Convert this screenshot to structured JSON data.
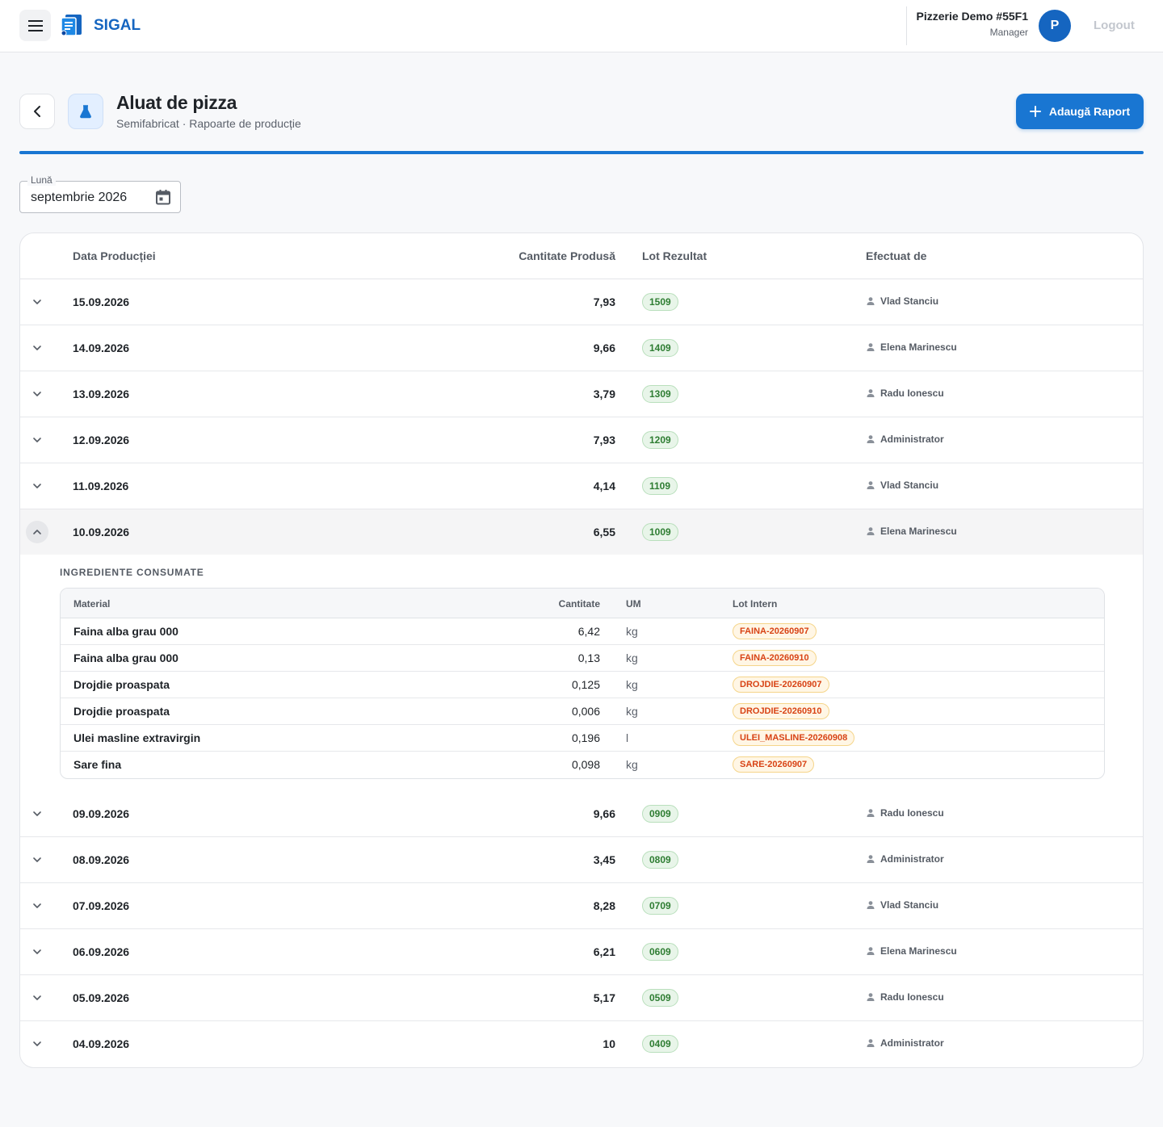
{
  "app": {
    "brand": "SIGAL",
    "org_name": "Pizzerie Demo #55F1",
    "org_role": "Manager",
    "avatar_letter": "P",
    "logout_label": "Logout"
  },
  "page": {
    "title": "Aluat de pizza",
    "subtitle": "Semifabricat · Rapoarte de producție",
    "add_button_label": "Adaugă Raport"
  },
  "filter": {
    "month_label": "Lună",
    "month_value": "septembrie 2026"
  },
  "table": {
    "headers": {
      "date": "Data Producției",
      "qty": "Cantitate Produsă",
      "lot": "Lot Rezultat",
      "user": "Efectuat de"
    },
    "rows": [
      {
        "date": "15.09.2026",
        "qty": "7,93",
        "lot": "1509",
        "user": "Vlad Stanciu"
      },
      {
        "date": "14.09.2026",
        "qty": "9,66",
        "lot": "1409",
        "user": "Elena Marinescu"
      },
      {
        "date": "13.09.2026",
        "qty": "3,79",
        "lot": "1309",
        "user": "Radu Ionescu"
      },
      {
        "date": "12.09.2026",
        "qty": "7,93",
        "lot": "1209",
        "user": "Administrator"
      },
      {
        "date": "11.09.2026",
        "qty": "4,14",
        "lot": "1109",
        "user": "Vlad Stanciu"
      },
      {
        "date": "10.09.2026",
        "qty": "6,55",
        "lot": "1009",
        "user": "Elena Marinescu"
      },
      {
        "date": "09.09.2026",
        "qty": "9,66",
        "lot": "0909",
        "user": "Radu Ionescu"
      },
      {
        "date": "08.09.2026",
        "qty": "3,45",
        "lot": "0809",
        "user": "Administrator"
      },
      {
        "date": "07.09.2026",
        "qty": "8,28",
        "lot": "0709",
        "user": "Vlad Stanciu"
      },
      {
        "date": "06.09.2026",
        "qty": "6,21",
        "lot": "0609",
        "user": "Elena Marinescu"
      },
      {
        "date": "05.09.2026",
        "qty": "5,17",
        "lot": "0509",
        "user": "Radu Ionescu"
      },
      {
        "date": "04.09.2026",
        "qty": "10",
        "lot": "0409",
        "user": "Administrator"
      }
    ]
  },
  "detail": {
    "title": "INGREDIENTE CONSUMATE",
    "headers": {
      "material": "Material",
      "qty": "Cantitate",
      "um": "UM",
      "lot": "Lot Intern"
    },
    "rows": [
      {
        "material": "Faina alba grau 000",
        "qty": "6,42",
        "um": "kg",
        "lot": "FAINA-20260907"
      },
      {
        "material": "Faina alba grau 000",
        "qty": "0,13",
        "um": "kg",
        "lot": "FAINA-20260910"
      },
      {
        "material": "Drojdie proaspata",
        "qty": "0,125",
        "um": "kg",
        "lot": "DROJDIE-20260907"
      },
      {
        "material": "Drojdie proaspata",
        "qty": "0,006",
        "um": "kg",
        "lot": "DROJDIE-20260910"
      },
      {
        "material": "Ulei masline extravirgin",
        "qty": "0,196",
        "um": "l",
        "lot": "ULEI_MASLINE-20260908"
      },
      {
        "material": "Sare fina",
        "qty": "0,098",
        "um": "kg",
        "lot": "SARE-20260907"
      }
    ]
  }
}
